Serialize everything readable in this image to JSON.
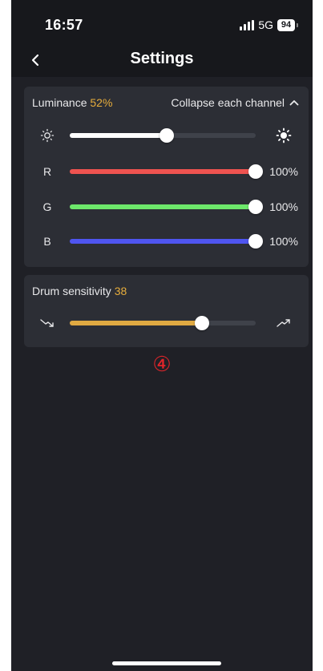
{
  "status_bar": {
    "time": "16:57",
    "network": "5G",
    "battery": "94"
  },
  "nav": {
    "title": "Settings",
    "back_icon": "chevron-left-icon"
  },
  "luminance": {
    "label": "Luminance",
    "value_text": "52%",
    "value": 52,
    "collapse_label": "Collapse each channel",
    "collapse_icon": "chevron-up-icon",
    "left_icon": "sun-dim-icon",
    "right_icon": "sun-bright-icon",
    "fill_color": "#ffffff"
  },
  "channels": [
    {
      "label": "R",
      "value": 100,
      "value_text": "100%",
      "color": "#ef5350"
    },
    {
      "label": "G",
      "value": 100,
      "value_text": "100%",
      "color": "#6de86b"
    },
    {
      "label": "B",
      "value": 100,
      "value_text": "100%",
      "color": "#4f55f0"
    }
  ],
  "drum": {
    "label": "Drum sensitivity",
    "value_text": "38",
    "value": 71,
    "left_icon": "trend-down-icon",
    "right_icon": "trend-up-icon",
    "fill_color": "#e0aa42"
  },
  "annotation": "④",
  "colors": {
    "background": "#1f2026",
    "card": "#2c2e35",
    "accent": "#e7ad3c",
    "track": "#3f424a",
    "annotation": "#e3252a"
  }
}
